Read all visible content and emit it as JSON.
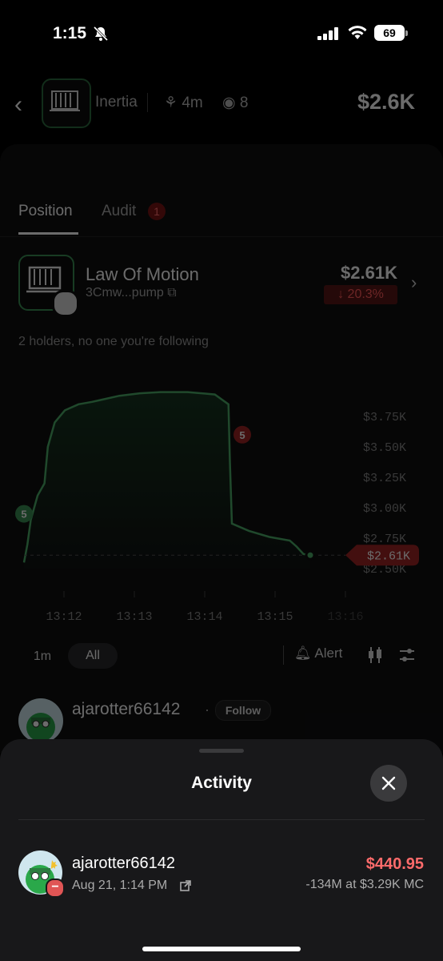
{
  "status": {
    "time": "1:15",
    "battery": "69"
  },
  "header": {
    "name": "Inertia",
    "age": "4m",
    "watchers": "8",
    "market_cap": "$2.6K"
  },
  "tabs": [
    {
      "label": "Position"
    },
    {
      "label": "Audit",
      "badge": "1"
    }
  ],
  "token": {
    "name": "Law Of Motion",
    "address": "3Cmw...pump",
    "price": "$2.61K",
    "change": "↓ 20.3%"
  },
  "holders_text": "2 holders, no one you're following",
  "chart_data": {
    "type": "line",
    "x_ticks": [
      "13:12",
      "13:13",
      "13:14",
      "13:15",
      "13:16"
    ],
    "y_ticks": [
      "$3.75K",
      "$3.50K",
      "$3.25K",
      "$3.00K",
      "$2.75K",
      "$2.50K"
    ],
    "current_label": "$2.61K",
    "markers": [
      {
        "label": "5",
        "color": "#3b8f55"
      },
      {
        "label": "5",
        "color": "#a02525"
      }
    ],
    "series": [
      {
        "x": [
          0,
          0.05,
          0.1,
          0.2,
          0.3,
          0.35,
          0.45,
          0.6,
          0.8,
          1.0,
          1.4,
          1.7,
          2.0,
          2.4,
          2.8,
          3.0,
          3.02,
          3.05,
          3.3,
          3.6,
          3.9,
          4.0,
          4.1,
          4.2
        ],
        "y": [
          2.55,
          2.7,
          2.9,
          3.1,
          3.2,
          3.5,
          3.7,
          3.8,
          3.85,
          3.87,
          3.92,
          3.94,
          3.95,
          3.95,
          3.93,
          3.85,
          3.4,
          2.87,
          2.81,
          2.76,
          2.73,
          2.68,
          2.62,
          2.61
        ]
      }
    ]
  },
  "controls": {
    "range_1m": "1m",
    "range_all": "All",
    "alert": "Alert"
  },
  "trader": {
    "username": "ajarotter66142",
    "follow": "Follow"
  },
  "sheet": {
    "title": "Activity",
    "item": {
      "username": "ajarotter66142",
      "date": "Aug 21, 1:14 PM",
      "amount": "$440.95",
      "detail": "-134M at $3.29K MC"
    }
  }
}
